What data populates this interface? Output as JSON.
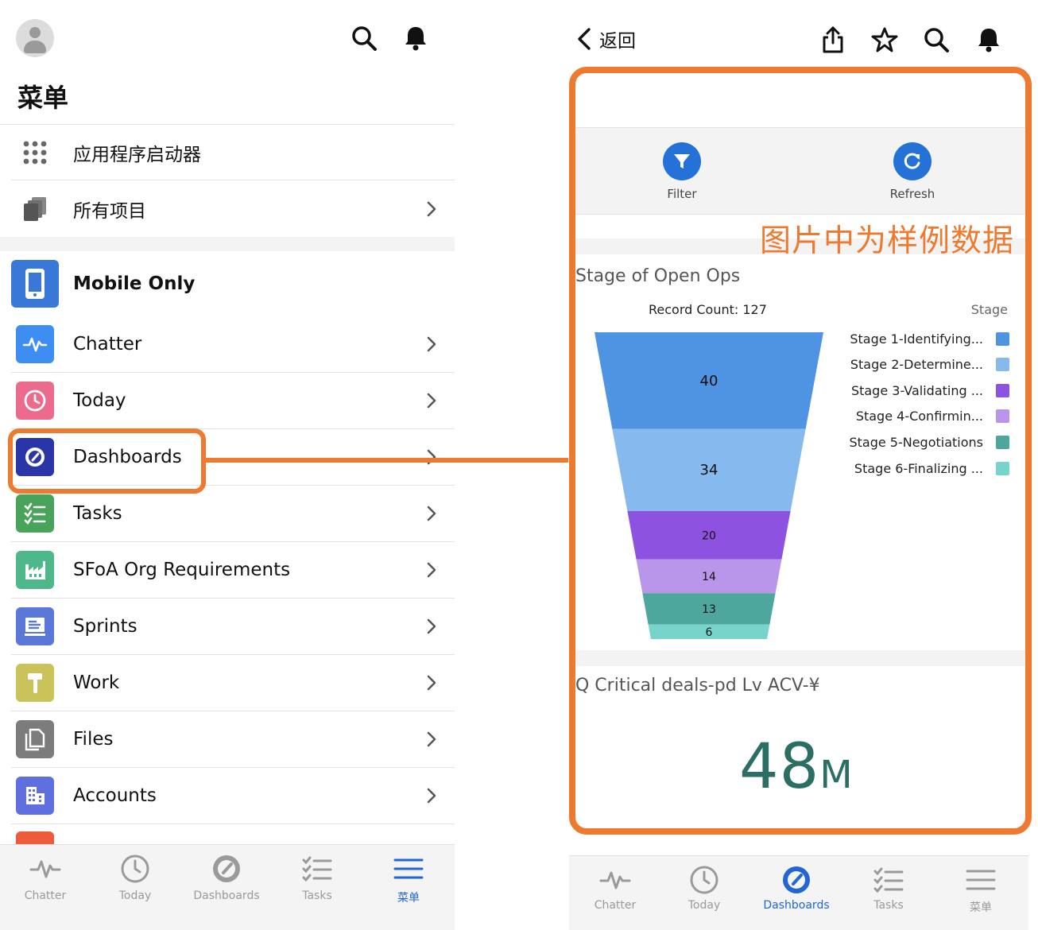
{
  "left": {
    "title": "菜单",
    "items": [
      {
        "label": "应用程序启动器"
      },
      {
        "label": "所有项目"
      },
      {
        "label": "Mobile Only"
      },
      {
        "label": "Chatter"
      },
      {
        "label": "Today"
      },
      {
        "label": "Dashboards"
      },
      {
        "label": "Tasks"
      },
      {
        "label": "SFoA Org Requirements"
      },
      {
        "label": "Sprints"
      },
      {
        "label": "Work"
      },
      {
        "label": "Files"
      },
      {
        "label": "Accounts"
      }
    ],
    "tabs": [
      "Chatter",
      "Today",
      "Dashboards",
      "Tasks",
      "菜单"
    ],
    "active_tab": "菜单"
  },
  "right": {
    "back_label": "返回",
    "filter_label": "Filter",
    "refresh_label": "Refresh",
    "watermark": "图片中为样例数据",
    "card1_title": "Stage of Open Ops",
    "record_count": "Record Count: 127",
    "legend_title": "Stage",
    "card2_title": "Q Critical deals-pd Lv ACV-¥",
    "kpi_value": "48",
    "kpi_unit": "M",
    "tabs": [
      "Chatter",
      "Today",
      "Dashboards",
      "Tasks",
      "菜单"
    ],
    "active_tab": "Dashboards"
  },
  "colors": {
    "accent_orange": "#ee7a2f",
    "brand_blue": "#2472d8",
    "kpi_teal": "#2b6e64"
  },
  "chart_data": {
    "type": "funnel",
    "title": "Stage of Open Ops",
    "subtitle": "Record Count: 127",
    "legend_title": "Stage",
    "legend_position": "right",
    "categories": [
      "Stage 1-Identifying...",
      "Stage 2-Determine...",
      "Stage 3-Validating ...",
      "Stage 4-Confirmin...",
      "Stage 5-Negotiations",
      "Stage 6-Finalizing ..."
    ],
    "values": [
      40,
      34,
      20,
      14,
      13,
      6
    ],
    "colors": [
      "#4f93e3",
      "#86b9ee",
      "#8d52e0",
      "#b996ea",
      "#4ea79c",
      "#76d4cc"
    ]
  }
}
